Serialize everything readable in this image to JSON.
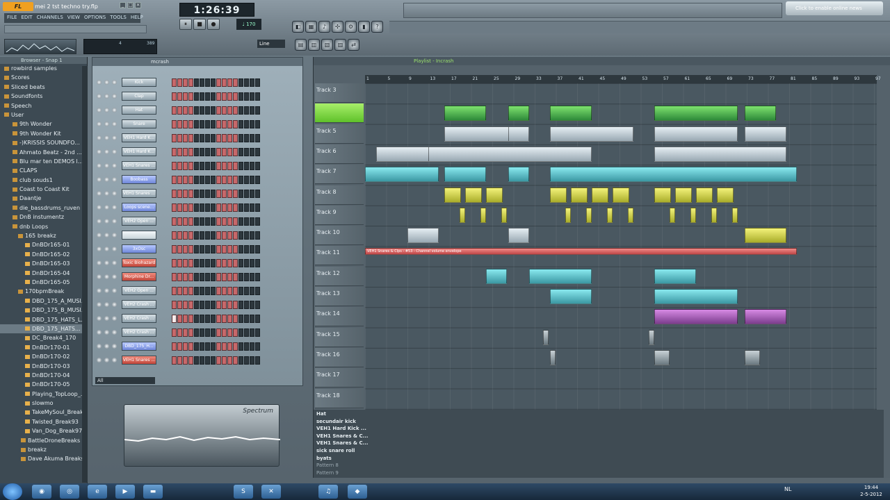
{
  "app": {
    "logo": "FL STUDIO",
    "project": "mei 2 tst techno try.flp",
    "menu": [
      "FILE",
      "EDIT",
      "CHANNELS",
      "VIEW",
      "OPTIONS",
      "TOOLS",
      "HELP"
    ],
    "time": "1:26:39",
    "cpu_a": "4",
    "cpu_b": "389",
    "snap": "Line",
    "hint": "Click to enable online news"
  },
  "transport": {
    "buttons": [
      "⏸",
      "■",
      "●"
    ],
    "icons": [
      "pause-icon",
      "stop-icon",
      "record-icon"
    ]
  },
  "browser": {
    "title": "Browser - Snap 1",
    "items": [
      {
        "label": "rowbird samples",
        "type": "folder"
      },
      {
        "label": "Scores",
        "type": "folder"
      },
      {
        "label": "Sliced beats",
        "type": "folder"
      },
      {
        "label": "Soundfonts",
        "type": "folder"
      },
      {
        "label": "Speech",
        "type": "folder"
      },
      {
        "label": "User",
        "type": "folder"
      },
      {
        "label": "9th Wonder",
        "type": "folder"
      },
      {
        "label": "9th Wonder Kit",
        "type": "folder"
      },
      {
        "label": "-)KRISSIS SOUNDFO...",
        "type": "folder"
      },
      {
        "label": "Ahmato Beatz - 2nd ...",
        "type": "folder"
      },
      {
        "label": "Blu mar ten DEMOS l...",
        "type": "folder"
      },
      {
        "label": "CLAPS",
        "type": "folder"
      },
      {
        "label": "club souds1",
        "type": "folder"
      },
      {
        "label": "Coast to Coast Kit",
        "type": "folder"
      },
      {
        "label": "Daantje",
        "type": "folder"
      },
      {
        "label": "die_bassdrums_ruven",
        "type": "folder"
      },
      {
        "label": "DnB instumentz",
        "type": "folder"
      },
      {
        "label": "dnb Loops",
        "type": "folder"
      },
      {
        "label": "165 breakz",
        "type": "folder"
      },
      {
        "label": "DnBDr165-01",
        "type": "file"
      },
      {
        "label": "DnBDr165-02",
        "type": "file"
      },
      {
        "label": "DnBDr165-03",
        "type": "file"
      },
      {
        "label": "DnBDr165-04",
        "type": "file"
      },
      {
        "label": "DnBDr165-05",
        "type": "file"
      },
      {
        "label": "170bpmBreak",
        "type": "folder"
      },
      {
        "label": "DBD_175_A_MUSI...",
        "type": "file"
      },
      {
        "label": "DBD_175_B_MUSI...",
        "type": "file"
      },
      {
        "label": "DBD_175_HATS_L...",
        "type": "file"
      },
      {
        "label": "DBD_175_HATS...",
        "type": "file",
        "selected": true
      },
      {
        "label": "DC_Break4_170",
        "type": "file"
      },
      {
        "label": "DnBDr170-01",
        "type": "file"
      },
      {
        "label": "DnBDr170-02",
        "type": "file"
      },
      {
        "label": "DnBDr170-03",
        "type": "file"
      },
      {
        "label": "DnBDr170-04",
        "type": "file"
      },
      {
        "label": "DnBDr170-05",
        "type": "file"
      },
      {
        "label": "Playing_TopLoop_...",
        "type": "file"
      },
      {
        "label": "slowmo",
        "type": "file"
      },
      {
        "label": "TakeMySoul_Break...",
        "type": "file"
      },
      {
        "label": "Twisted_Break93",
        "type": "file"
      },
      {
        "label": "Van_Dog_Break97",
        "type": "file"
      },
      {
        "label": "BattleDroneBreaks",
        "type": "folder"
      },
      {
        "label": "breakz",
        "type": "folder"
      },
      {
        "label": "Dave Akuma Breaks",
        "type": "folder"
      }
    ]
  },
  "rack": {
    "title": "mcrash",
    "filter": "All",
    "channels": [
      {
        "name": "Kick",
        "style": "grey"
      },
      {
        "name": "Clap",
        "style": "grey"
      },
      {
        "name": "Hat",
        "style": "grey"
      },
      {
        "name": "Snare",
        "style": "grey"
      },
      {
        "name": "VEH1 Hard K...",
        "style": "grey"
      },
      {
        "name": "VEH1 Hard K...",
        "style": "grey"
      },
      {
        "name": "VEH1 Snares ...",
        "style": "grey"
      },
      {
        "name": "Boobass",
        "style": "blue"
      },
      {
        "name": "VEH1 Snares ...",
        "style": "grey"
      },
      {
        "name": "Loops scene...",
        "style": "blue"
      },
      {
        "name": "VEH2 Open ...",
        "style": "grey"
      },
      {
        "name": "",
        "style": "white"
      },
      {
        "name": "3xOsc",
        "style": "blue"
      },
      {
        "name": "Toxic Biohazard",
        "style": "red"
      },
      {
        "name": "Morphine Dr...",
        "style": "red"
      },
      {
        "name": "VEH2 Open ...",
        "style": "grey"
      },
      {
        "name": "VEH2 Crash ...",
        "style": "grey"
      },
      {
        "name": "VEH2 Crash ...",
        "style": "grey"
      },
      {
        "name": "VEH2 Crash ...",
        "style": "grey"
      },
      {
        "name": "DBD_175_H...",
        "style": "blue"
      },
      {
        "name": "VEH1 Snares ...",
        "style": "red"
      }
    ]
  },
  "spectrum": {
    "label": "Spectrum"
  },
  "playlist": {
    "title": "Playlist - Incrash",
    "ruler": [
      "1",
      "5",
      "9",
      "13",
      "17",
      "21",
      "25",
      "29",
      "33",
      "37",
      "41",
      "45",
      "49",
      "53",
      "57",
      "61",
      "65",
      "69",
      "73",
      "77",
      "81",
      "85",
      "89",
      "93",
      "97"
    ],
    "tracks": [
      "Track 3",
      "",
      "Track 5",
      "Track 6",
      "Track 7",
      "Track 8",
      "Track 9",
      "Track 10",
      "Track 11",
      "Track 12",
      "Track 13",
      "Track 14",
      "Track 15",
      "Track 16",
      "Track 17",
      "Track 18"
    ],
    "automation_label": "VEH1 Snares & Clps - #53 - Channel volume envelope",
    "patterns": [
      "Hat",
      "secundair kick",
      "VEH1 Hard Kick ...",
      "VEH1 Snares & C...",
      "VEH1 Snares & C...",
      "sick snare roll",
      "byats",
      "Pattern 8",
      "Pattern 9"
    ]
  },
  "taskbar": {
    "lang": "NL",
    "time": "19:44",
    "date": "2-5-2012"
  }
}
